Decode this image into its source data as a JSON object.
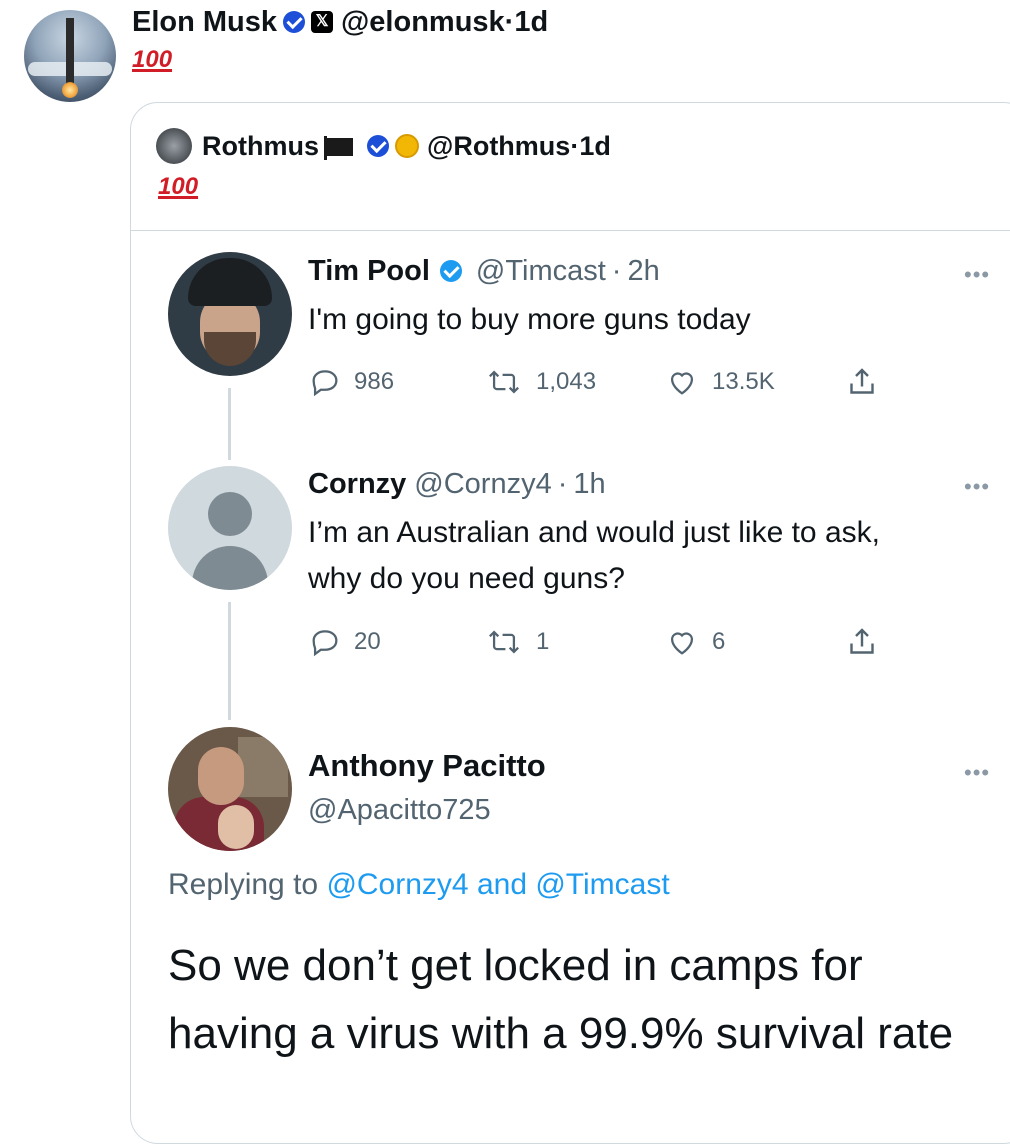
{
  "outer": {
    "name": "Elon Musk",
    "handle": "@elonmusk",
    "time": "1d",
    "text": "100"
  },
  "quote": {
    "name": "Rothmus",
    "handle": "@Rothmus",
    "time": "1d",
    "text": "100"
  },
  "tweets": [
    {
      "name": "Tim Pool",
      "handle": "@Timcast",
      "time": "2h",
      "body": "I'm going to buy more guns today",
      "replies": "986",
      "retweets": "1,043",
      "likes": "13.5K"
    },
    {
      "name": "Cornzy",
      "handle": "@Cornzy4",
      "time": "1h",
      "body_line1": "I’m an Australian and would just like to ask,",
      "body_line2": "why do you need guns?",
      "replies": "20",
      "retweets": "1",
      "likes": "6"
    }
  ],
  "reply": {
    "name": "Anthony Pacitto",
    "handle": "@Apacitto725",
    "replying_prefix": "Replying to ",
    "replying_to_1": "@Cornzy4",
    "replying_and": " and ",
    "replying_to_2": "@Timcast",
    "body": "So we don’t get locked in camps for having a virus with a 99.9% survival rate"
  },
  "separator": "·",
  "more": "•••",
  "colors": {
    "verified": "#1d9bf0",
    "link": "#1d9bf0",
    "muted": "#536471",
    "border": "#cfd9de"
  }
}
